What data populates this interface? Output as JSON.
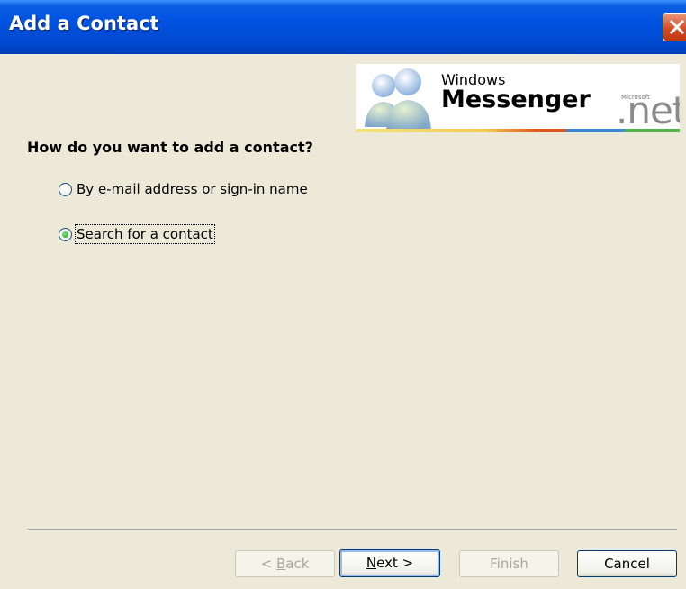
{
  "window": {
    "title": "Add a Contact"
  },
  "logo": {
    "windows": "Windows",
    "messenger": "Messenger",
    "microsoft": "Microsoft",
    "net": ".net"
  },
  "prompt": "How do you want to add a contact?",
  "options": [
    {
      "prefix": "By ",
      "accel": "e",
      "suffix": "-mail address or sign-in name",
      "selected": false
    },
    {
      "prefix": "",
      "accel": "S",
      "suffix": "earch for a contact",
      "selected": true
    }
  ],
  "buttons": {
    "back": {
      "prefix": "< ",
      "accel": "B",
      "suffix": "ack",
      "enabled": false
    },
    "next": {
      "prefix": "",
      "accel": "N",
      "suffix": "ext >",
      "enabled": true
    },
    "finish": {
      "label": "Finish",
      "enabled": false
    },
    "cancel": {
      "label": "Cancel",
      "enabled": true
    }
  }
}
